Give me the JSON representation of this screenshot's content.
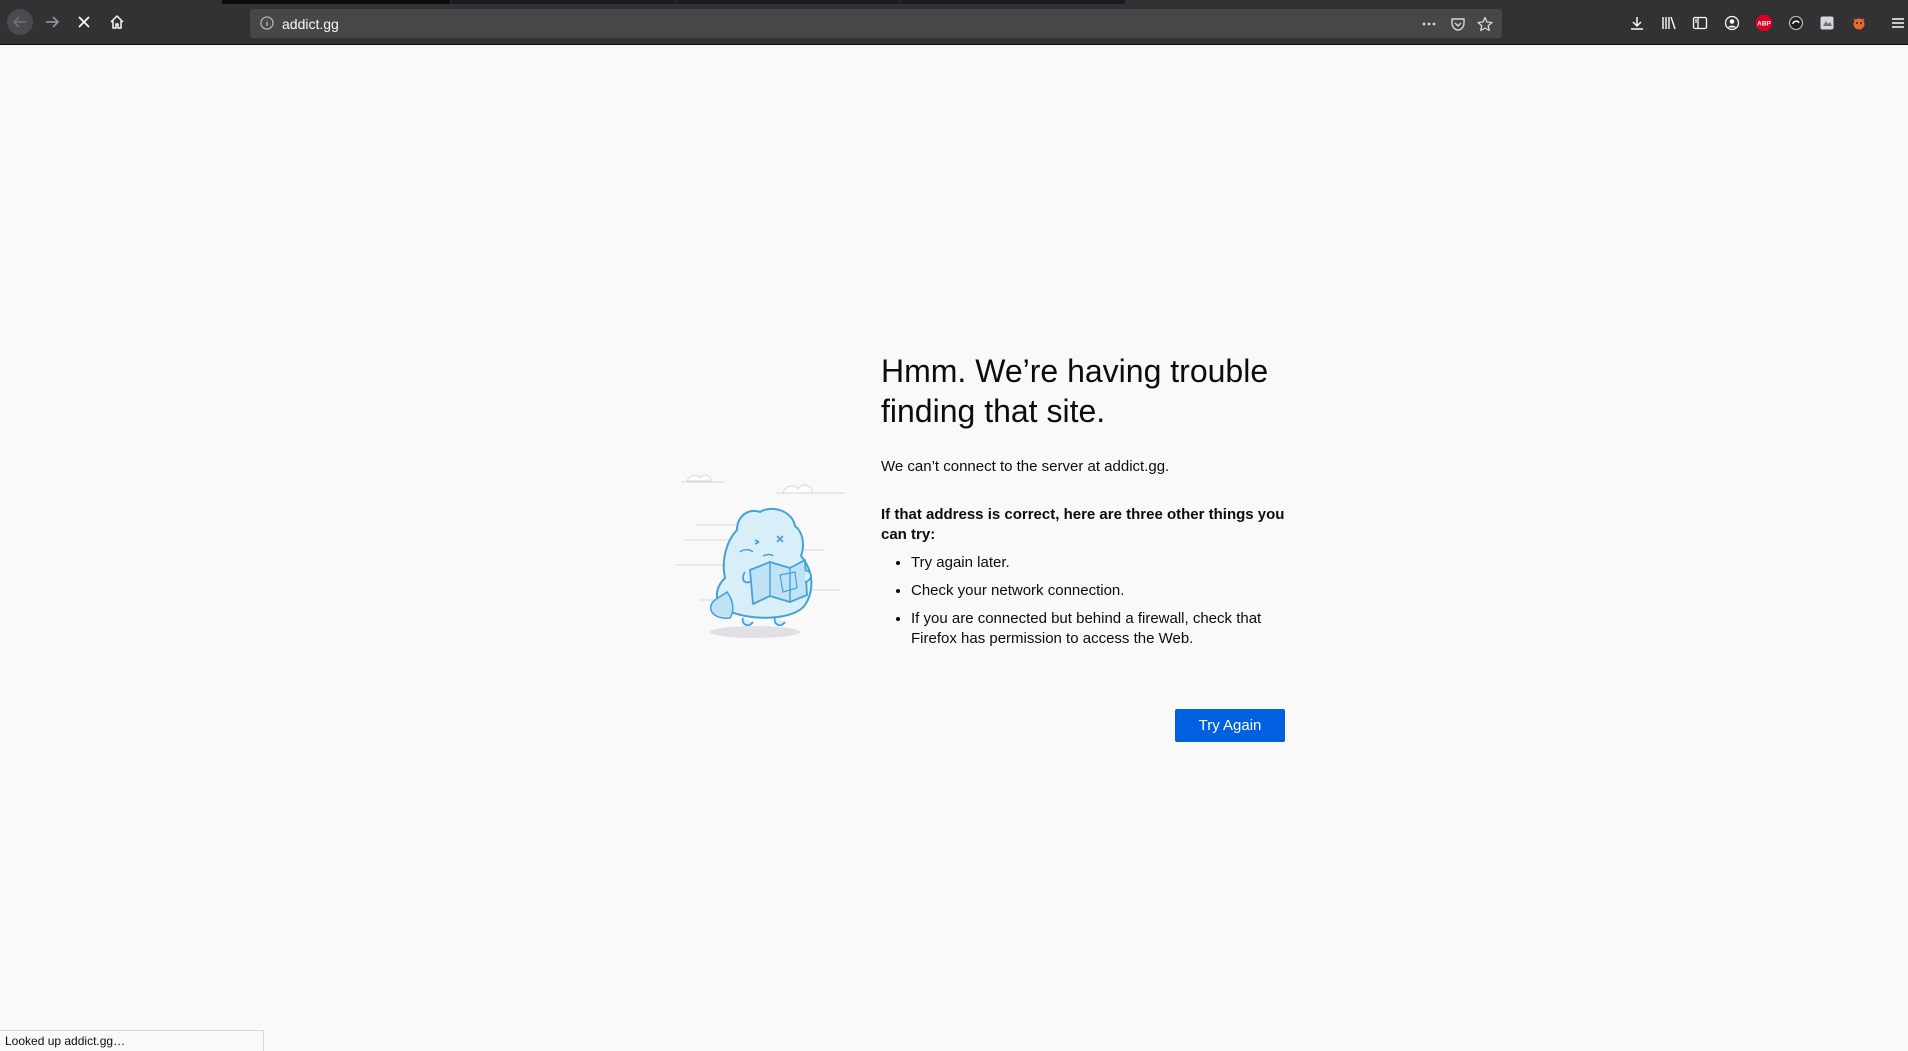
{
  "browser": {
    "url": "addict.gg",
    "status_text": "Looked up addict.gg…",
    "toolbar_icons": [
      "back-icon",
      "forward-icon",
      "stop-icon",
      "home-icon",
      "page-actions-icon",
      "pocket-icon",
      "bookmark-star-icon",
      "downloads-icon",
      "library-icon",
      "sidebar-icon",
      "account-icon",
      "adblock-plus-icon",
      "extension-icon",
      "extension-icon-2",
      "extension-icon-3",
      "menu-icon"
    ],
    "adblock_label": "ABP"
  },
  "error_page": {
    "title": "Hmm. We’re having trouble finding that site.",
    "description": "We can’t connect to the server at addict.gg.",
    "suggestion_heading": "If that address is correct, here are three other things you can try:",
    "suggestions": [
      "Try again later.",
      "Check your network connection.",
      "If you are connected but behind a firewall, check that Firefox has permission to access the Web."
    ],
    "try_again_label": "Try Again"
  },
  "colors": {
    "toolbar_bg": "#323234",
    "urlbar_bg": "#474749",
    "page_bg": "#f9f9fa",
    "button_blue": "#0060df",
    "illustration_blue": "#45a1d9",
    "adblock_red": "#d70022"
  }
}
